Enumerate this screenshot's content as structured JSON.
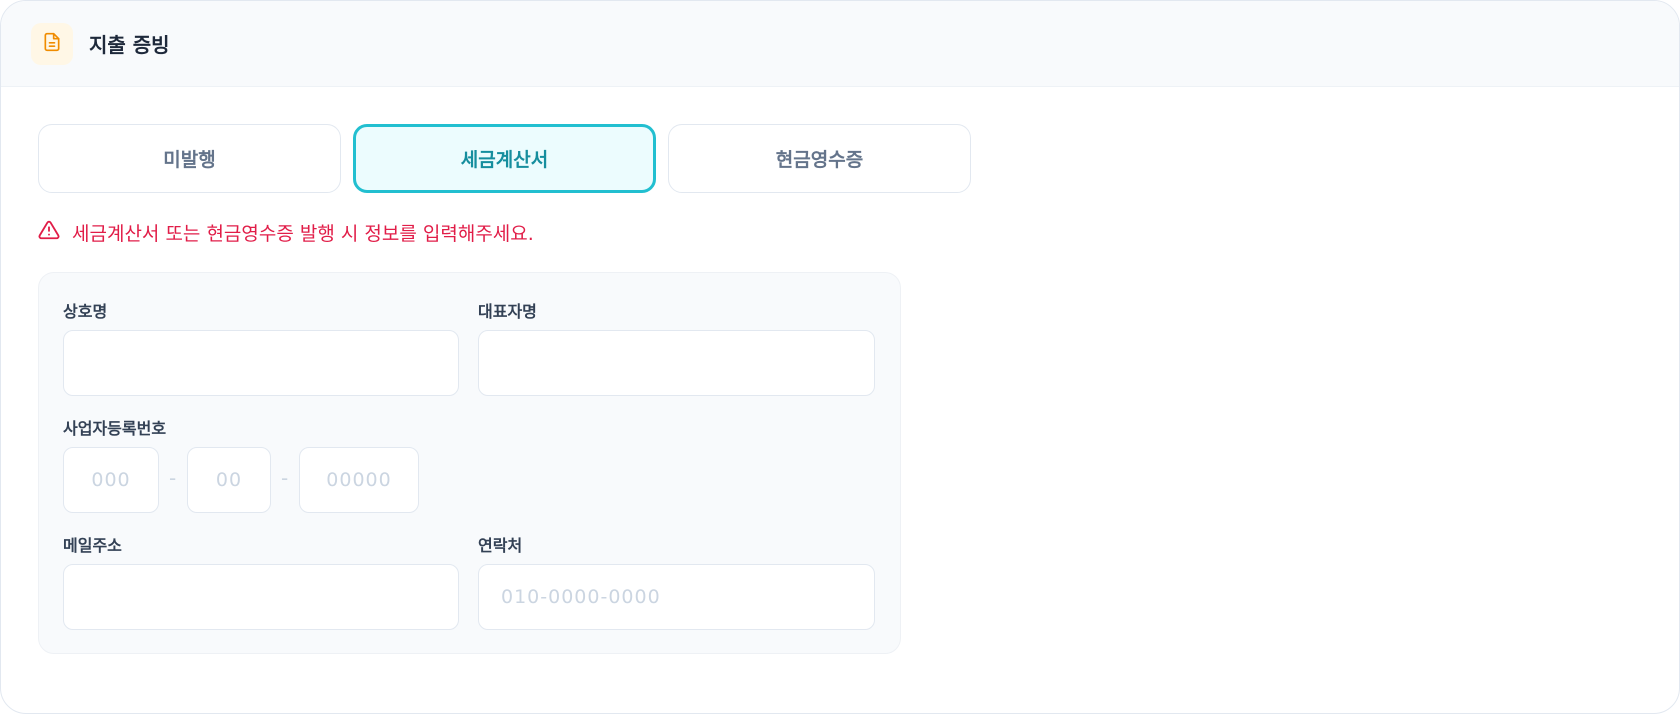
{
  "header": {
    "title": "지출 증빙",
    "icon": "document-icon",
    "icon_color": "#f08c00"
  },
  "tabs": [
    {
      "label": "미발행",
      "active": false
    },
    {
      "label": "세금계산서",
      "active": true
    },
    {
      "label": "현금영수증",
      "active": false
    }
  ],
  "warning": {
    "icon": "alert-triangle-icon",
    "text": "세금계산서 또는 현금영수증 발행 시 정보를 입력해주세요.",
    "color": "#e11d48"
  },
  "form": {
    "company_name": {
      "label": "상호명",
      "value": "",
      "placeholder": ""
    },
    "representative": {
      "label": "대표자명",
      "value": "",
      "placeholder": ""
    },
    "business_number": {
      "label": "사업자등록번호",
      "part1_placeholder": "000",
      "part2_placeholder": "00",
      "part3_placeholder": "00000",
      "separator": "-"
    },
    "email": {
      "label": "메일주소",
      "value": "",
      "placeholder": ""
    },
    "phone": {
      "label": "연락처",
      "value": "",
      "placeholder": "010-0000-0000"
    }
  },
  "colors": {
    "accent": "#22bfd0",
    "accent_text": "#168e9e",
    "accent_bg": "#ecfcfe"
  }
}
